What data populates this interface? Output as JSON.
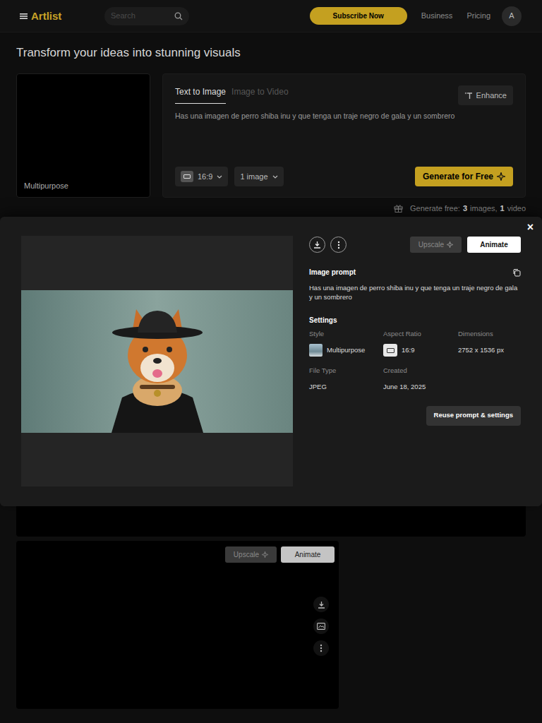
{
  "header": {
    "logo": "Artlist",
    "search": {
      "placeholder": "Search"
    },
    "subscribe": "Subscribe Now",
    "nav": [
      "Business",
      "Pricing"
    ],
    "avatar": "A"
  },
  "page_title": "Transform your ideas into stunning visuals",
  "style_card": {
    "label": "Multipurpose"
  },
  "generator": {
    "tabs": [
      {
        "label": "Text to Image",
        "selected": true
      },
      {
        "label": "Image to Video",
        "selected": false
      }
    ],
    "enhance": "Enhance",
    "prompt": "Has una imagen de perro shiba inu y que tenga un traje negro de gala y un sombrero",
    "aspect_ratio": "16:9",
    "image_count": "1 image",
    "generate": "Generate for Free"
  },
  "quota": [
    {
      "text": "Generate free:",
      "bold": false
    },
    {
      "text": "3",
      "bold": true
    },
    {
      "text": "images,",
      "bold": false
    },
    {
      "text": "1",
      "bold": true
    },
    {
      "text": "video",
      "bold": false
    }
  ],
  "modal": {
    "close": "×",
    "upscale": {
      "label": "Upscale",
      "disabled": true
    },
    "animate": "Animate",
    "prompt_label": "Image prompt",
    "prompt": "Has una imagen de perro shiba inu y que tenga un traje negro de gala y un sombrero",
    "settings_label": "Settings",
    "settings": [
      {
        "label": "Style",
        "value": "Multipurpose",
        "kind": "thumbnail"
      },
      {
        "label": "Aspect Ratio",
        "value": "16:9",
        "kind": "ratio"
      },
      {
        "label": "Dimensions",
        "value": "2752 x 1536 px",
        "kind": "plain"
      },
      {
        "label": "File Type",
        "value": "JPEG",
        "kind": "plain"
      },
      {
        "label": "Created",
        "value": "June 18, 2025",
        "kind": "plain"
      }
    ],
    "reuse": "Reuse prompt & settings"
  },
  "gallery": [
    {
      "upscale": {
        "label": "Upscale",
        "disabled": true
      },
      "animate": "Animate"
    }
  ]
}
